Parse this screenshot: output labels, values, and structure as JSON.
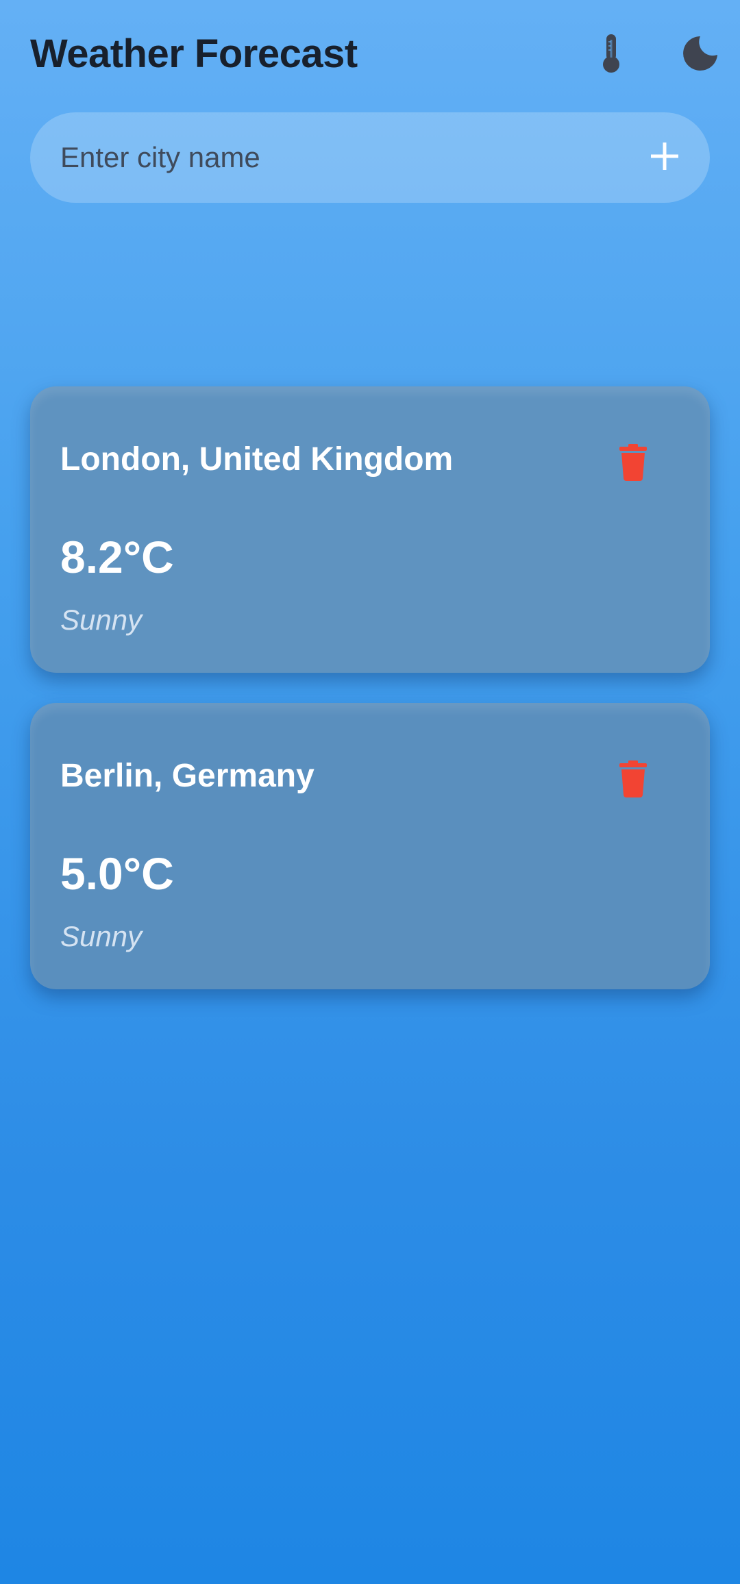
{
  "app": {
    "title": "Weather Forecast"
  },
  "header": {
    "units_icon": "thermometer-icon",
    "theme_icon": "moon-icon"
  },
  "search": {
    "placeholder": "Enter city name",
    "value": "",
    "add_icon": "plus-icon"
  },
  "cities": [
    {
      "name": "London, United Kingdom",
      "temperature": "8.2°C",
      "condition": "Sunny",
      "delete_icon": "trash-icon"
    },
    {
      "name": "Berlin, Germany",
      "temperature": "5.0°C",
      "condition": "Sunny",
      "delete_icon": "trash-icon"
    }
  ],
  "colors": {
    "background_top": "#64B0F5",
    "background_bottom": "#1E86E4",
    "card": "#5F93C0",
    "delete": "#F24433",
    "header_icon": "#3F4450"
  }
}
